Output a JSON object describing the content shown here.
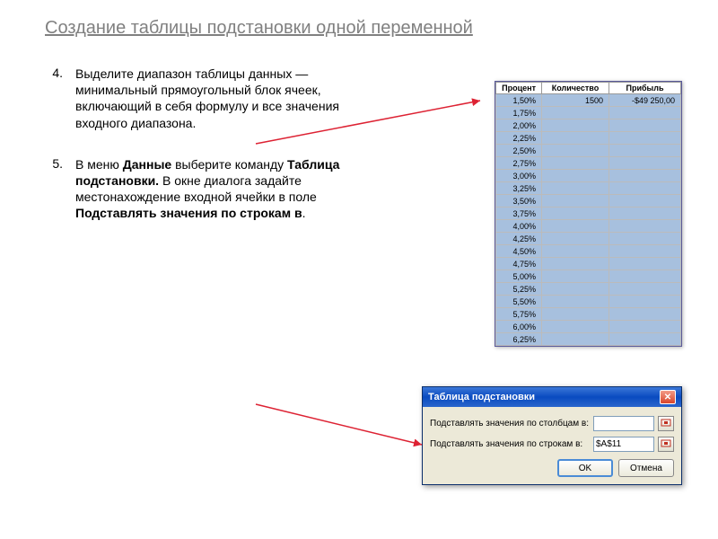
{
  "title": "Создание таблицы подстановки одной переменной",
  "items": [
    {
      "num": "4.",
      "html": "Выделите диапазон таблицы данных — минимальный прямоугольный блок ячеек, включающий в себя формулу и все значения входного диапазона."
    },
    {
      "num": "5.",
      "html": "В меню <b>Данные</b> выберите команду <b>Таблица подстановки.</b> В окне диалога задайте местонахождение входной ячейки в поле <b>Подставлять значения по строкам в</b>."
    }
  ],
  "table": {
    "headers": [
      "Процент",
      "Количество",
      "Прибыль"
    ],
    "first_row": {
      "p": "1,50%",
      "q": "1500",
      "r": "-$49 250,00"
    },
    "percents": [
      "1,75%",
      "2,00%",
      "2,25%",
      "2,50%",
      "2,75%",
      "3,00%",
      "3,25%",
      "3,50%",
      "3,75%",
      "4,00%",
      "4,25%",
      "4,50%",
      "4,75%",
      "5,00%",
      "5,25%",
      "5,50%",
      "5,75%",
      "6,00%",
      "6,25%"
    ]
  },
  "dialog": {
    "title": "Таблица подстановки",
    "row1_label": "Подставлять значения по столбцам в:",
    "row1_value": "",
    "row2_label": "Подставлять значения по строкам в:",
    "row2_value": "$A$11",
    "ok": "OK",
    "cancel": "Отмена"
  }
}
